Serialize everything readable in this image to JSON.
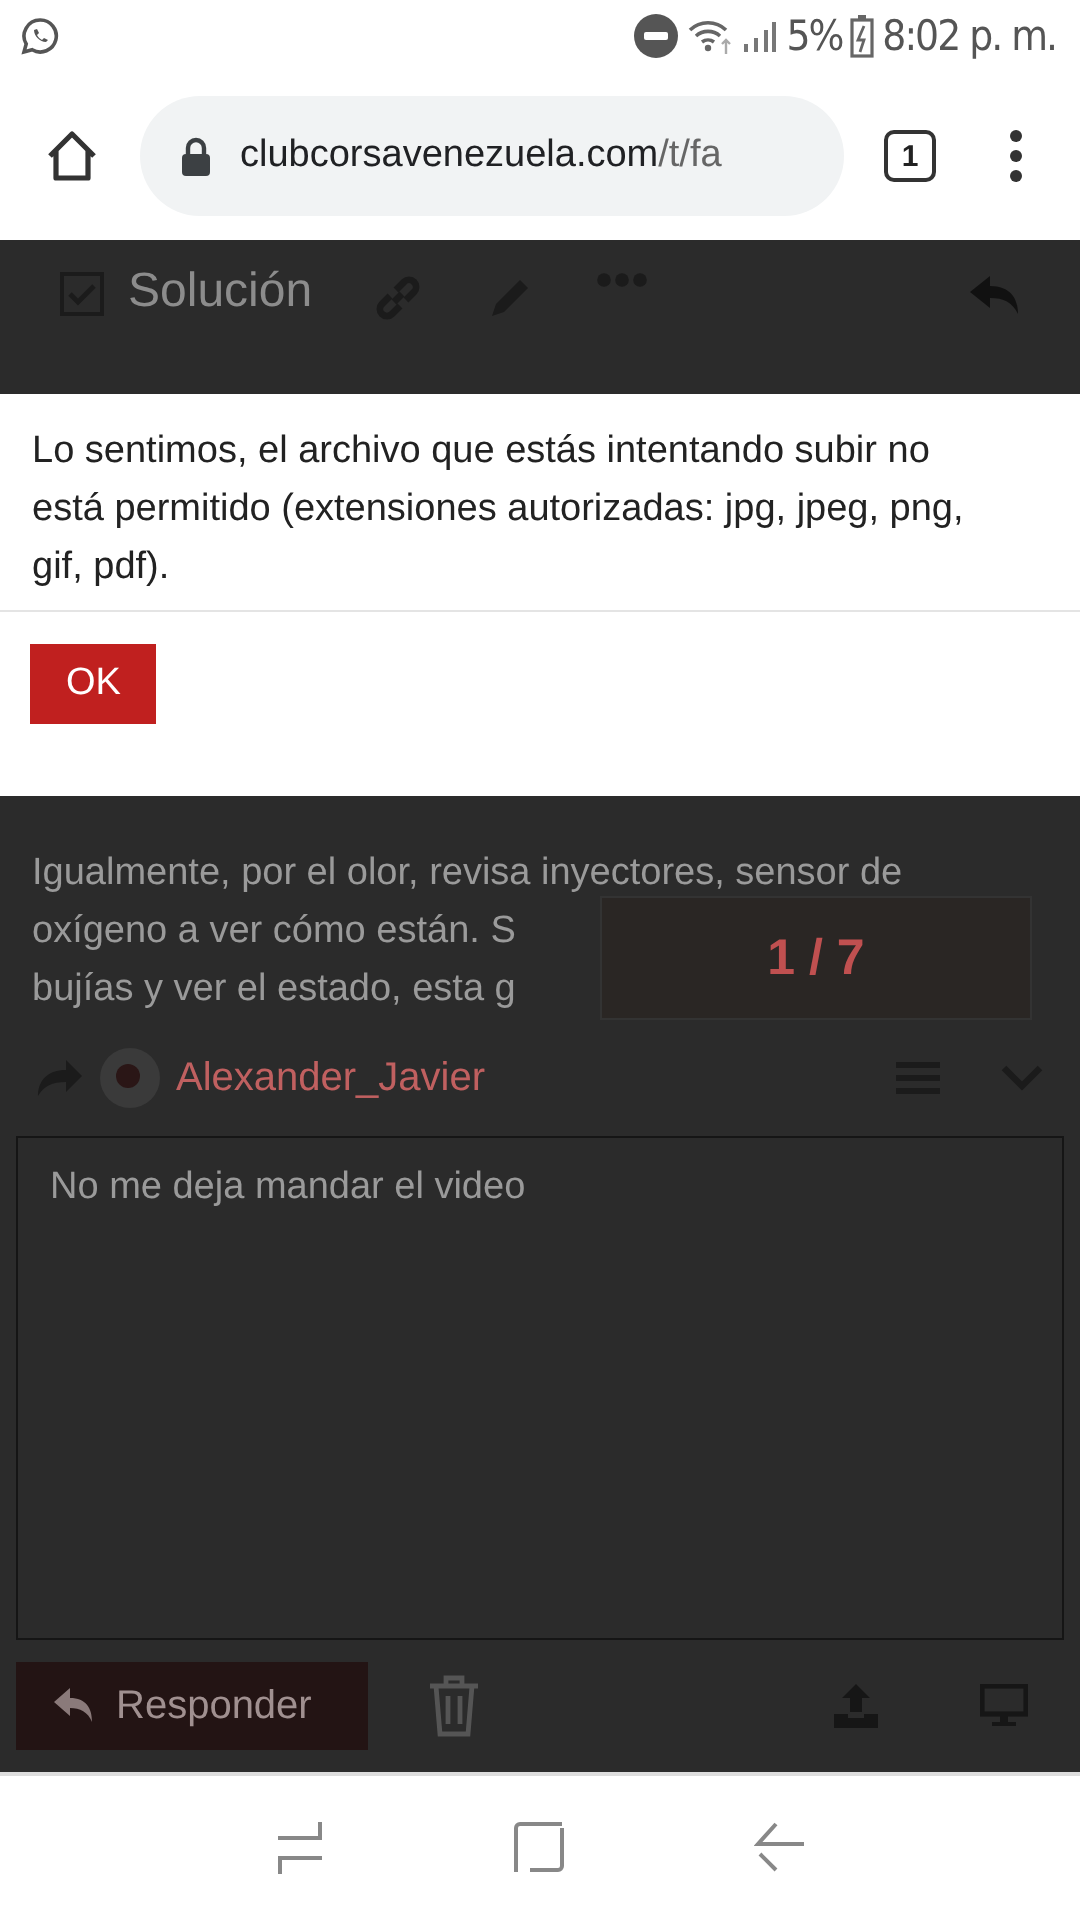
{
  "status_bar": {
    "battery": "5%",
    "time": "8:02 p. m."
  },
  "browser": {
    "url_host": "clubcorsavenezuela.com",
    "url_path": "/t/fa",
    "tab_count": "1"
  },
  "post_toolbar": {
    "solution_label": "Solución"
  },
  "dialog": {
    "message": "Lo sentimos, el archivo que estás intentando subir no está permitido (extensiones autorizadas: jpg, jpeg, png, gif, pdf).",
    "button": "OK"
  },
  "post": {
    "lines": [
      "Igualmente, por el olor, revisa inyectores, sensor de",
      "oxígeno a ver cómo están. S",
      "bujías y ver el estado, esta g"
    ],
    "counter": "1 / 7"
  },
  "composer": {
    "reply_to": "Alexander_Javier",
    "value": "No me deja mandar el video",
    "submit": "Responder"
  }
}
